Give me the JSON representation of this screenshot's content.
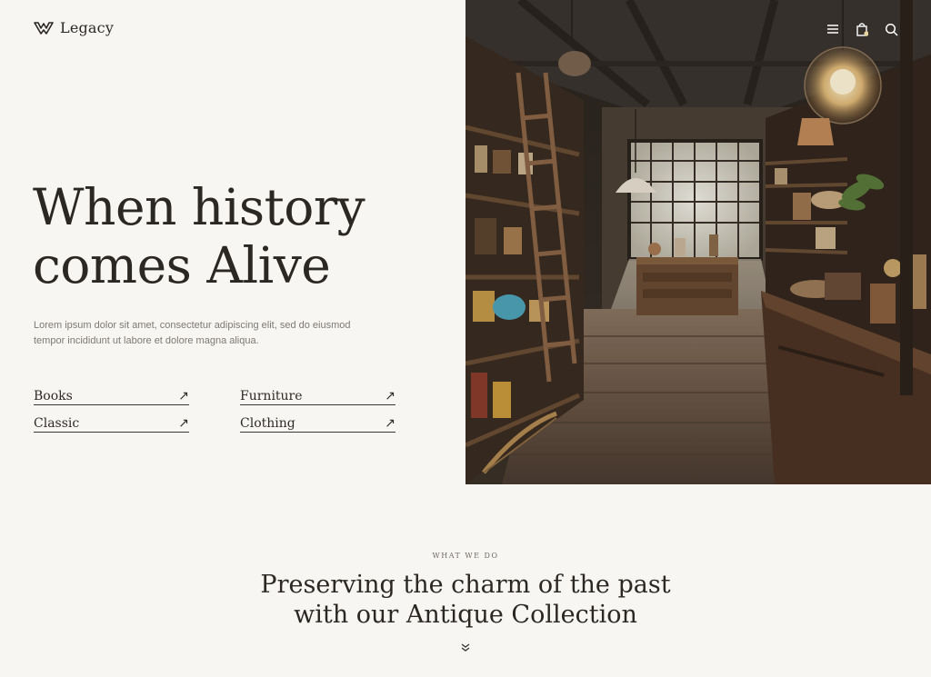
{
  "brand": {
    "name": "Legacy"
  },
  "hero": {
    "title_line_1": "When history",
    "title_line_2": "comes Alive",
    "description": "Lorem ipsum dolor sit amet, consectetur adipiscing elit, sed do eiusmod tempor incididunt ut labore et dolore magna aliqua."
  },
  "categories": [
    {
      "label": "Books",
      "arrow": "↗"
    },
    {
      "label": "Furniture",
      "arrow": "↗"
    },
    {
      "label": "Classic",
      "arrow": "↗"
    },
    {
      "label": "Clothing",
      "arrow": "↗"
    }
  ],
  "header_icons": [
    "menu-icon",
    "shopping-bag-icon",
    "search-icon"
  ],
  "section": {
    "eyebrow": "WHAT WE DO",
    "title_line_1": "Preserving the charm of the past",
    "title_line_2": "with our Antique Collection"
  },
  "colors": {
    "background": "#f8f6f3",
    "text_dark": "#2b2823",
    "text_muted": "#7d7973"
  }
}
